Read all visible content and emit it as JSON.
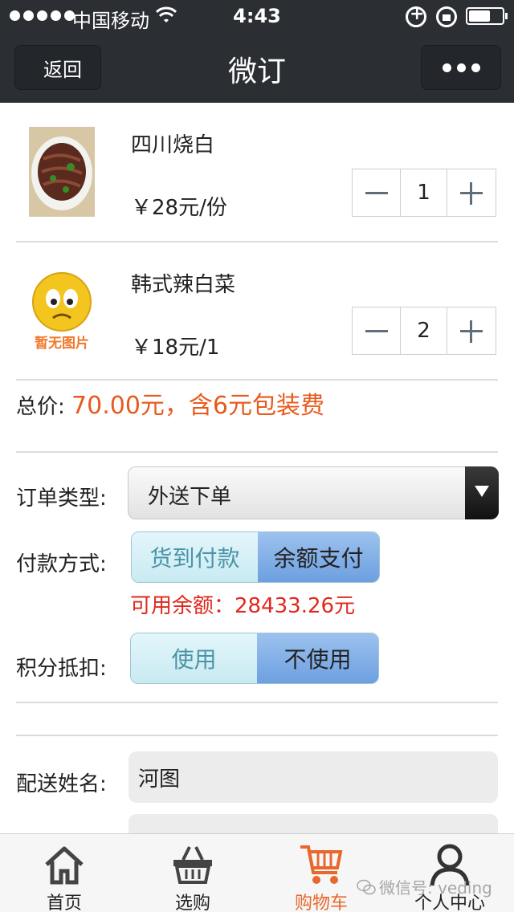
{
  "status_bar": {
    "carrier": "中国移动",
    "time": "4:43"
  },
  "nav": {
    "back_label": "返回",
    "title": "微订"
  },
  "cart_items": [
    {
      "name": "四川烧白",
      "price": "￥28元/份",
      "quantity": "1",
      "image": "braised-pork-dish-photo"
    },
    {
      "name": "韩式辣白菜",
      "price": "￥18元/1",
      "quantity": "2",
      "image": "no-image-placeholder",
      "image_text": "暂无图片"
    }
  ],
  "total": {
    "label": "总价:",
    "value": "70.00元，含6元包装费"
  },
  "order_type": {
    "label": "订单类型:",
    "selected": "外送下单"
  },
  "payment": {
    "label": "付款方式:",
    "options": [
      "货到付款",
      "余额支付"
    ],
    "selected_index": 1,
    "balance_text": "可用余额：28433.26元"
  },
  "points": {
    "label": "积分抵扣:",
    "options": [
      "使用",
      "不使用"
    ],
    "selected_index": 1
  },
  "delivery": {
    "name_label": "配送姓名:",
    "name_value": "河图"
  },
  "tabbar": {
    "items": [
      {
        "label": "首页",
        "icon": "home-icon"
      },
      {
        "label": "选购",
        "icon": "basket-icon"
      },
      {
        "label": "购物车",
        "icon": "cart-icon"
      },
      {
        "label": "个人中心",
        "icon": "user-icon"
      }
    ],
    "active_index": 2
  },
  "watermark": "微信号: veding",
  "colors": {
    "header": "#2b2e33",
    "price_accent": "#e85a1c",
    "balance_red": "#e0281d",
    "tab_active": "#e8672c"
  }
}
